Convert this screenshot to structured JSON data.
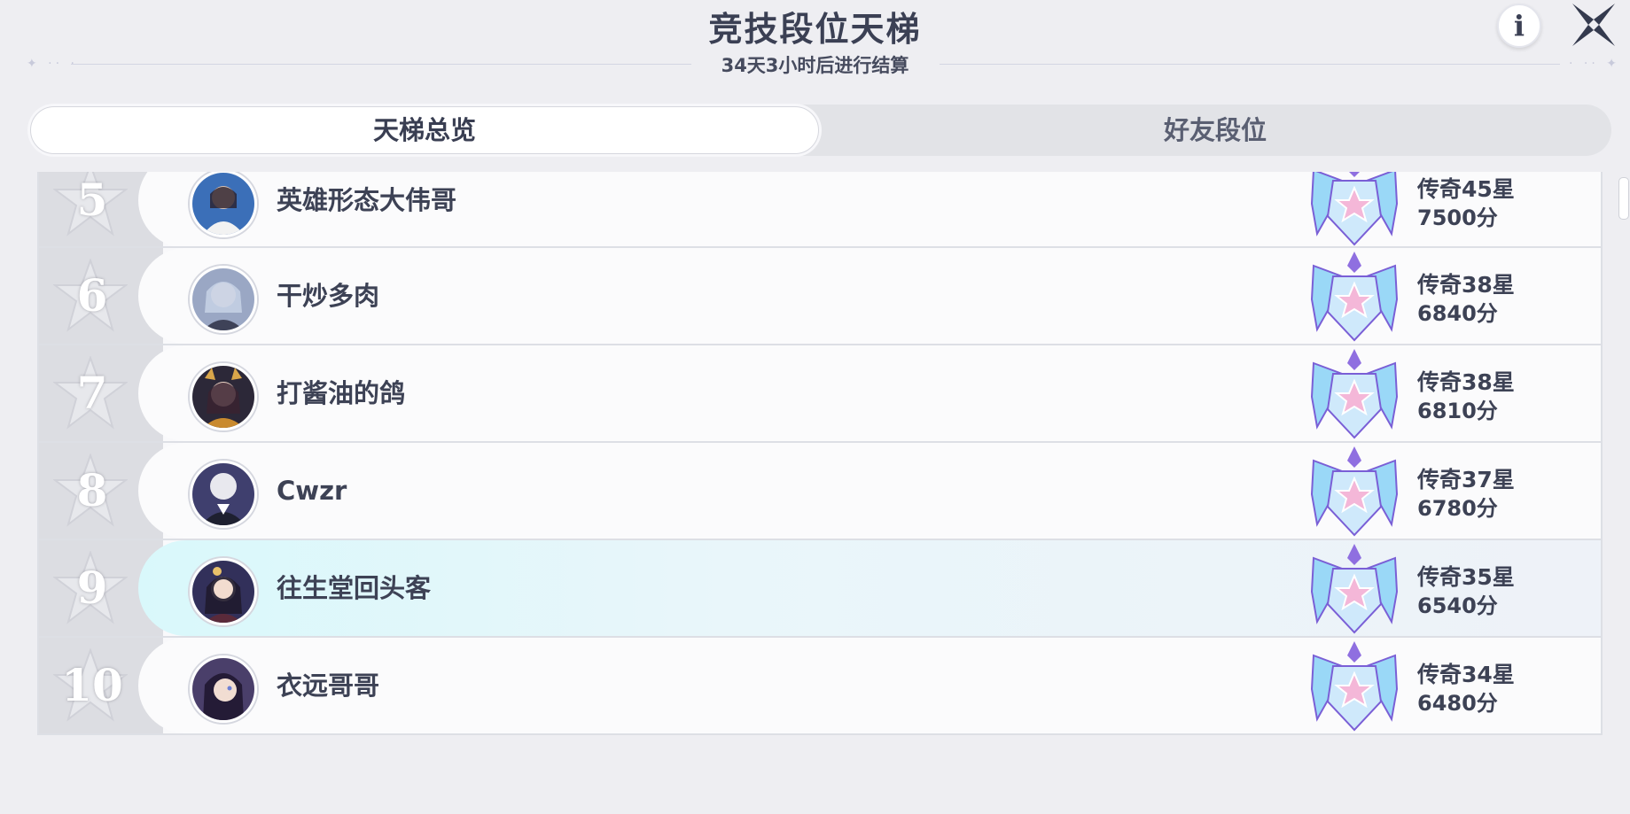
{
  "header": {
    "title": "竞技段位天梯",
    "countdown": "34天3小时后进行结算"
  },
  "icons": {
    "info": "info-icon",
    "close": "close-icon",
    "badge": "legend-rank-badge-icon"
  },
  "tabs": [
    {
      "label": "天梯总览",
      "active": true
    },
    {
      "label": "好友段位",
      "active": false
    }
  ],
  "ranking": [
    {
      "rank": "5",
      "name": "英雄形态大伟哥",
      "tier": "传奇45星",
      "score": "7500分",
      "avatar_color": "#3b6fb8",
      "highlighted": false
    },
    {
      "rank": "6",
      "name": "干炒多肉",
      "tier": "传奇38星",
      "score": "6840分",
      "avatar_color": "#9aa7c4",
      "highlighted": false
    },
    {
      "rank": "7",
      "name": "打酱油的鸽",
      "tier": "传奇38星",
      "score": "6810分",
      "avatar_color": "#2c2838",
      "highlighted": false
    },
    {
      "rank": "8",
      "name": "Cwzr",
      "tier": "传奇37星",
      "score": "6780分",
      "avatar_color": "#3f3f6e",
      "highlighted": false
    },
    {
      "rank": "9",
      "name": "往生堂回头客",
      "tier": "传奇35星",
      "score": "6540分",
      "avatar_color": "#32305a",
      "highlighted": true
    },
    {
      "rank": "10",
      "name": "衣远哥哥",
      "tier": "传奇34星",
      "score": "6480分",
      "avatar_color": "#4a3f6a",
      "highlighted": false
    }
  ],
  "colors": {
    "background": "#eeeef2",
    "highlight_row": "#d9f8fb",
    "badge_blue": "#7fd1f5",
    "badge_purple": "#8f6fe0",
    "badge_pink": "#f4b7d8"
  }
}
